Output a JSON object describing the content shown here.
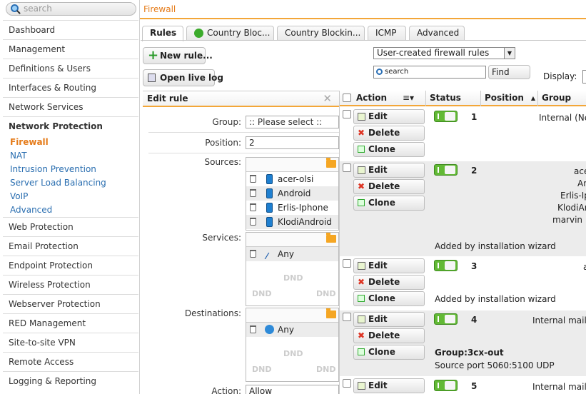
{
  "search": {
    "placeholder": "search"
  },
  "nav": {
    "items": [
      "Dashboard",
      "Management",
      "Definitions & Users",
      "Interfaces & Routing",
      "Network Services",
      "Network Protection"
    ],
    "sub": [
      "Firewall",
      "NAT",
      "Intrusion Prevention",
      "Server Load Balancing",
      "VoIP",
      "Advanced"
    ],
    "items2": [
      "Web Protection",
      "Email Protection",
      "Endpoint Protection",
      "Wireless Protection",
      "Webserver Protection",
      "RED Management",
      "Site-to-site VPN",
      "Remote Access",
      "Logging & Reporting"
    ]
  },
  "breadcrumb": "Firewall",
  "tabs": [
    "Rules",
    "Country Bloc...",
    "Country Blockin...",
    "ICMP",
    "Advanced"
  ],
  "toolbar": {
    "new_rule": "New rule...",
    "open_log": "Open live log",
    "filter": "User-created firewall rules",
    "search_placeholder": "search",
    "find": "Find",
    "display": "Display:"
  },
  "edit": {
    "title": "Edit rule",
    "group_label": "Group:",
    "group_value": ":: Please select ::",
    "position_label": "Position:",
    "position_value": "2",
    "sources_label": "Sources:",
    "sources": [
      "acer-olsi",
      "Android",
      "Erlis-Iphone",
      "KlodiAndroid"
    ],
    "services_label": "Services:",
    "services": [
      "Any"
    ],
    "destinations_label": "Destinations:",
    "destinations": [
      "Any"
    ],
    "action_label": "Action:",
    "action_value": "Allow",
    "dnd": "DND"
  },
  "table": {
    "headers": [
      "Action",
      "Status",
      "Position",
      "Group"
    ],
    "buttons": {
      "edit": "Edit",
      "delete": "Delete",
      "clone": "Clone"
    },
    "rows": [
      {
        "pos": "1",
        "group": "Internal (Net",
        "extra": [],
        "note": ""
      },
      {
        "pos": "2",
        "group": "ace",
        "extra": [
          "An",
          "Erlis-Ip",
          "KlodiAn",
          "marvin ip"
        ],
        "note": "Added by installation wizard"
      },
      {
        "pos": "3",
        "group": "a",
        "extra": [],
        "note": "Added by installation wizard"
      },
      {
        "pos": "4",
        "group": "Internal mail s",
        "extra": [],
        "note": "Group:3cx-out",
        "note2": "Source port 5060:5100 UDP"
      },
      {
        "pos": "5",
        "group": "Internal mail s",
        "extra": [],
        "note": ""
      }
    ]
  }
}
